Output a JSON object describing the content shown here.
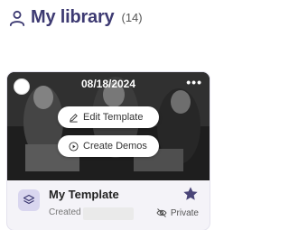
{
  "header": {
    "title": "My library",
    "count": "(14)",
    "icon": "user-icon"
  },
  "card": {
    "date": "08/18/2024",
    "more_label": "•••",
    "edit_label": "Edit Template",
    "demos_label": "Create Demos",
    "template_name": "My Template",
    "created_by_label": "Created by",
    "privacy_label": "Private"
  },
  "colors": {
    "title": "#3d3a72",
    "star": "#4a4578",
    "badge_bg": "#d9d6ef"
  }
}
